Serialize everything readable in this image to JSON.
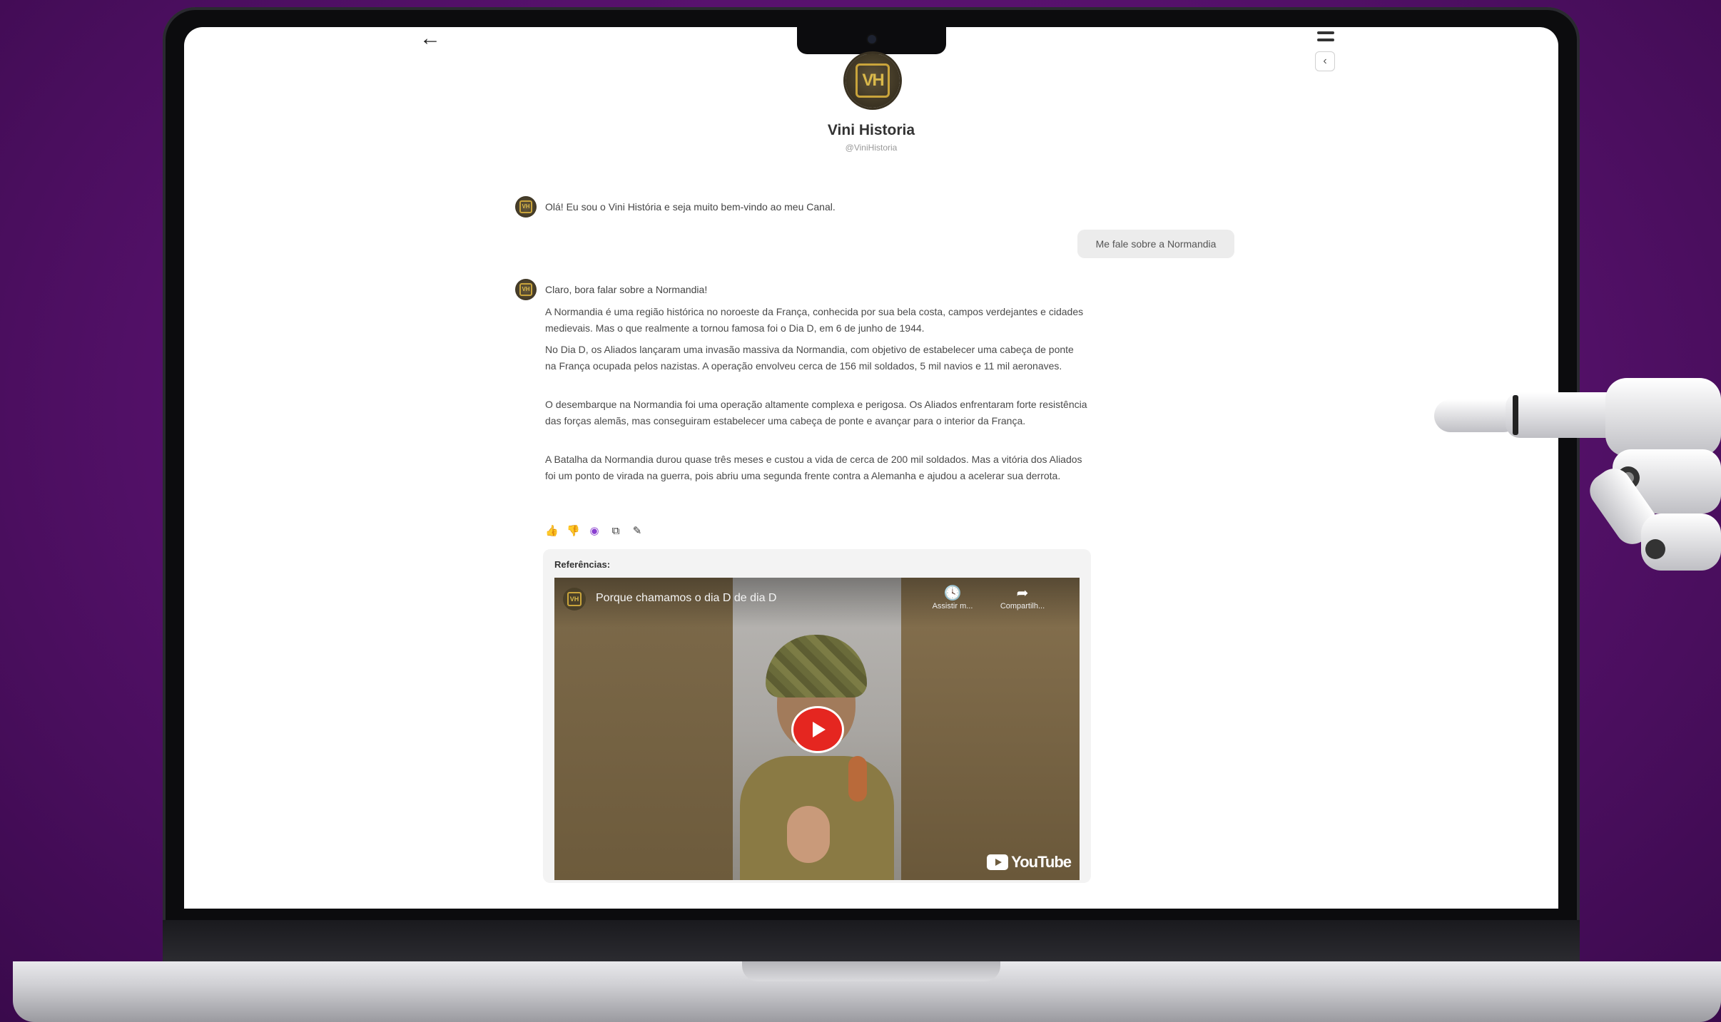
{
  "channel": {
    "name": "Vini Historia",
    "handle": "@ViniHistoria",
    "logo_text": "VH"
  },
  "messages": {
    "greeting": "Olá! Eu sou o Vini História e seja muito bem-vindo ao meu Canal.",
    "user_prompt": "Me fale sobre a Normandia",
    "reply_intro": "Claro, bora falar sobre a Normandia!",
    "paragraphs": [
      "A Normandia é uma região histórica no noroeste da França, conhecida por sua bela costa, campos verdejantes e cidades medievais. Mas o que realmente a tornou famosa foi o Dia D, em 6 de junho de 1944.",
      "No Dia D, os Aliados lançaram uma invasão massiva da Normandia, com objetivo de estabelecer uma cabeça de ponte na França ocupada pelos nazistas. A operação envolveu cerca de 156 mil soldados, 5 mil navios e 11 mil aeronaves.",
      "O desembarque na Normandia foi uma operação altamente complexa e perigosa. Os Aliados enfrentaram forte resistência das forças alemãs, mas conseguiram estabelecer uma cabeça de ponte e avançar para o interior da França.",
      "A Batalha da Normandia durou quase três meses e custou a vida de cerca de 200 mil soldados. Mas a vitória dos Aliados foi um ponto de virada na guerra, pois abriu uma segunda frente contra a Alemanha e ajudou a acelerar sua derrota."
    ]
  },
  "references": {
    "title": "Referências:",
    "video": {
      "title": "Porque chamamos o dia D de dia D",
      "watch_later": "Assistir m...",
      "share": "Compartilh...",
      "brand": "YouTube"
    }
  },
  "icons": {
    "back": "arrow-left",
    "menu": "hamburger",
    "collapse": "chevron-left",
    "actions": [
      "thumbs-up",
      "thumbs-down",
      "globe",
      "copy",
      "pencil"
    ]
  },
  "colors": {
    "background_purple": "#5a1270",
    "accent_gold": "#c9a43b",
    "youtube_red": "#e52620",
    "globe_purple": "#8a3fd0"
  }
}
